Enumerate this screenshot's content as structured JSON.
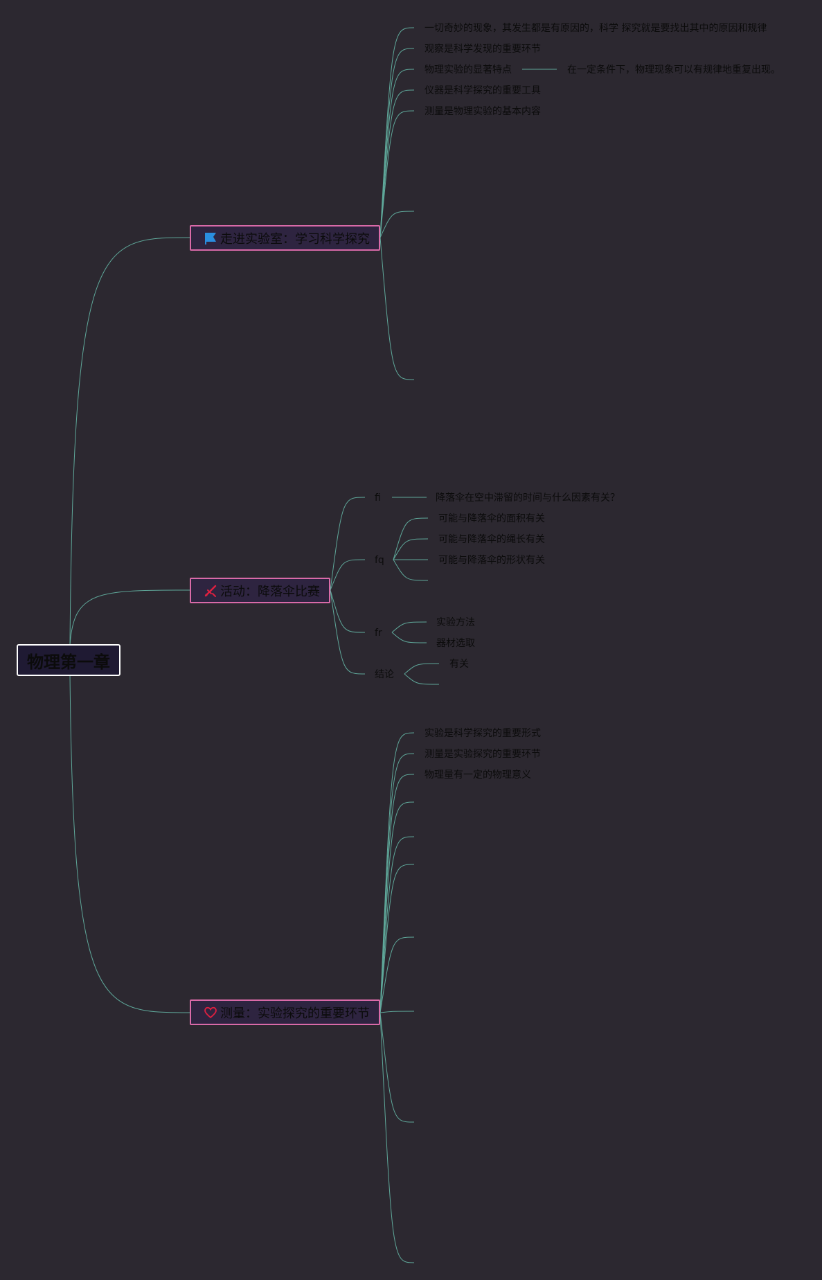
{
  "root": {
    "label": "物理第一章"
  },
  "colors": {
    "background": "#2c2830",
    "line": "#5fa89a",
    "topic_border": "#d96aa8",
    "root_border": "#ffffff",
    "flag": "#2a8ee0",
    "red": "#e02040"
  },
  "topics": [
    {
      "label": "走进实验室：学习科学探究",
      "icon": "flag-icon",
      "children": [
        {
          "label": "一切奇妙的现象，其发生都是有原因的，科学 探究就是要找出其中的原因和规律"
        },
        {
          "label": "观察是科学发现的重要环节"
        },
        {
          "label": "物理实验的显著特点",
          "detail": "在一定条件下，物理现象可以有规律地重复出现。"
        },
        {
          "label": "仪器是科学探究的重要工具"
        },
        {
          "label": "测量是物理实验的基本内容"
        }
      ]
    },
    {
      "label": "活动：降落伞比赛",
      "icon": "pencil-ruler-icon",
      "children": [
        {
          "label": "fi",
          "children": [
            {
              "label": "降落伞在空中滞留的时间与什么因素有关？"
            }
          ]
        },
        {
          "label": "fq",
          "children": [
            {
              "label": "可能与降落伞的面积有关"
            },
            {
              "label": "可能与降落伞的绳长有关"
            },
            {
              "label": "可能与降落伞的形状有关"
            }
          ]
        },
        {
          "label": "fr",
          "children": [
            {
              "label": "实验方法"
            },
            {
              "label": "器材选取"
            }
          ]
        },
        {
          "label": "结论",
          "children": [
            {
              "label": "有关"
            }
          ]
        }
      ]
    },
    {
      "label": "测量：实验探究的重要环节",
      "icon": "heart-icon",
      "children": [
        {
          "label": "实验是科学探究的重要形式"
        },
        {
          "label": "测量是实验探究的重要环节"
        },
        {
          "label": "物理量有一定的物理意义"
        }
      ]
    }
  ]
}
